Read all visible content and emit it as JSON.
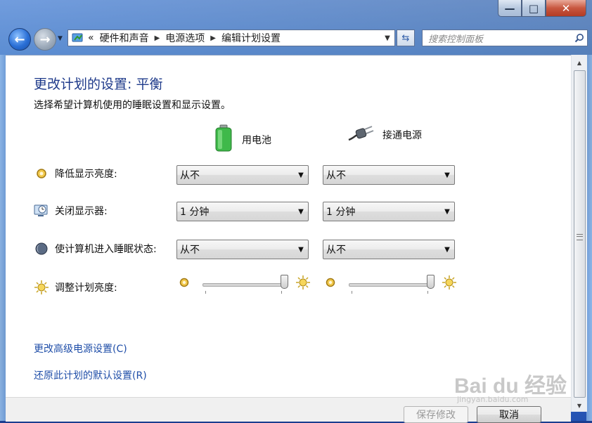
{
  "window": {
    "minimize_symbol": "—",
    "maximize_symbol": "□",
    "close_symbol": "✕"
  },
  "navigation": {
    "back_glyph": "←",
    "forward_glyph": "→",
    "breadcrumb_overflow": "«",
    "breadcrumbs": [
      "硬件和声音",
      "电源选项",
      "编辑计划设置"
    ],
    "search_placeholder": "搜索控制面板"
  },
  "page": {
    "title": "更改计划的设置: 平衡",
    "subtitle": "选择希望计算机使用的睡眠设置和显示设置。",
    "columns": {
      "battery": "用电池",
      "plugged_in": "接通电源"
    },
    "settings": [
      {
        "label": "降低显示亮度:",
        "battery": "从不",
        "plugged_in": "从不",
        "icon": "brightness-dim-icon"
      },
      {
        "label": "关闭显示器:",
        "battery": "1 分钟",
        "plugged_in": "1 分钟",
        "icon": "monitor-clock-icon"
      },
      {
        "label": "使计算机进入睡眠状态:",
        "battery": "从不",
        "plugged_in": "从不",
        "icon": "moon-sleep-icon"
      }
    ],
    "brightness": {
      "label": "调整计划亮度:",
      "battery_level": 1.0,
      "plugged_in_level": 1.0
    },
    "links": {
      "advanced": "更改高级电源设置(C)",
      "restore": "还原此计划的默认设置(R)"
    },
    "buttons": {
      "save": "保存修改",
      "cancel": "取消"
    }
  },
  "watermark": {
    "main": "Bai du 经验",
    "sub": "jingyan.baidu.com"
  },
  "colors": {
    "title_blue": "#1e3a8a",
    "link_blue": "#1f4ea8",
    "battery_green": "#3fb94a"
  }
}
